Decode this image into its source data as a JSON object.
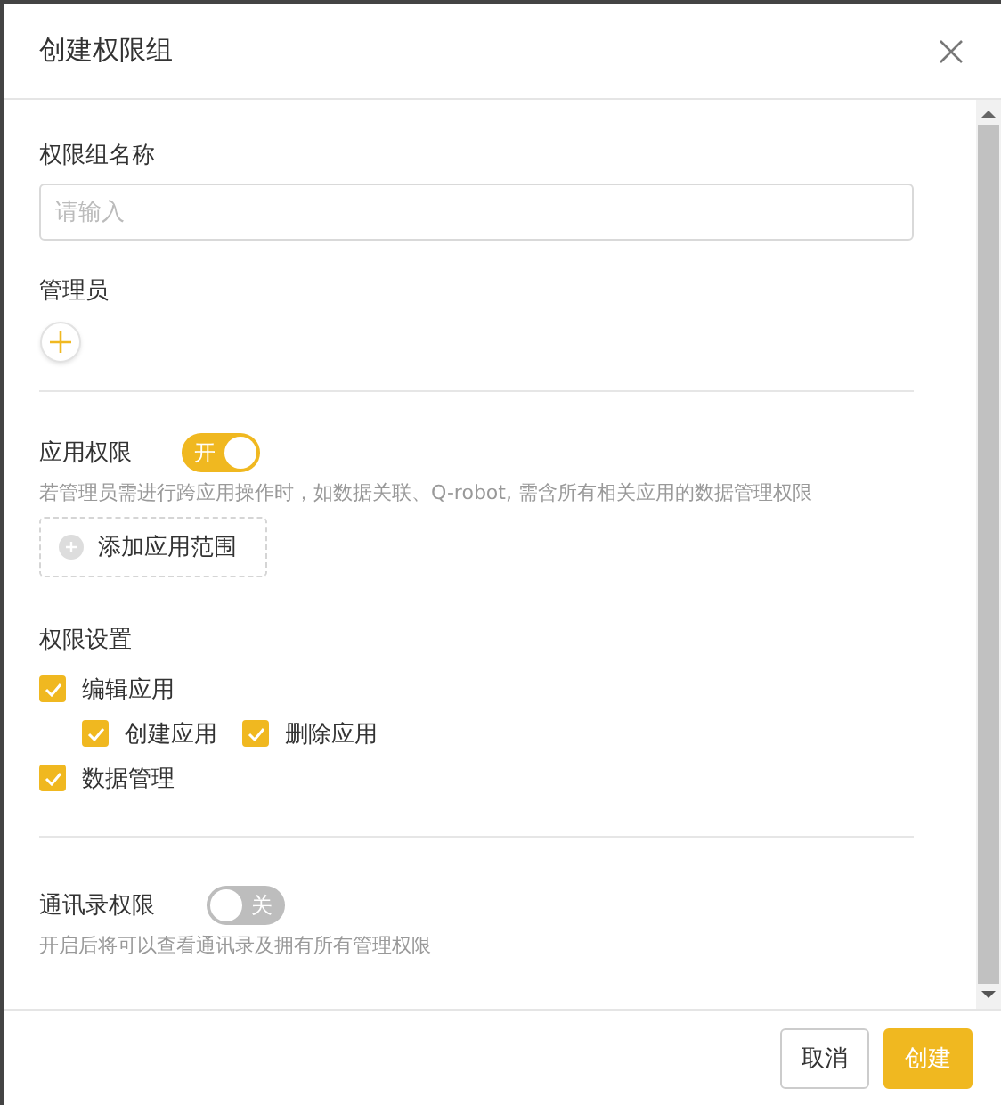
{
  "dialog": {
    "title": "创建权限组"
  },
  "name_field": {
    "label": "权限组名称",
    "placeholder": "请输入"
  },
  "admins": {
    "label": "管理员"
  },
  "app_permission": {
    "label": "应用权限",
    "toggle": {
      "on": true,
      "text": "开"
    },
    "hint": "若管理员需进行跨应用操作时，如数据关联、Q-robot, 需含所有相关应用的数据管理权限",
    "add_button": "添加应用范围"
  },
  "permission_settings": {
    "label": "权限设置",
    "items": [
      {
        "label": "编辑应用",
        "checked": true,
        "children": [
          {
            "label": "创建应用",
            "checked": true
          },
          {
            "label": "删除应用",
            "checked": true
          }
        ]
      },
      {
        "label": "数据管理",
        "checked": true
      }
    ]
  },
  "contacts_permission": {
    "label": "通讯录权限",
    "toggle": {
      "on": false,
      "text": "关"
    },
    "hint": "开启后将可以查看通讯录及拥有所有管理权限"
  },
  "buttons": [
    {
      "label": "取消",
      "kind": "secondary"
    },
    {
      "label": "创建",
      "kind": "primary"
    }
  ]
}
